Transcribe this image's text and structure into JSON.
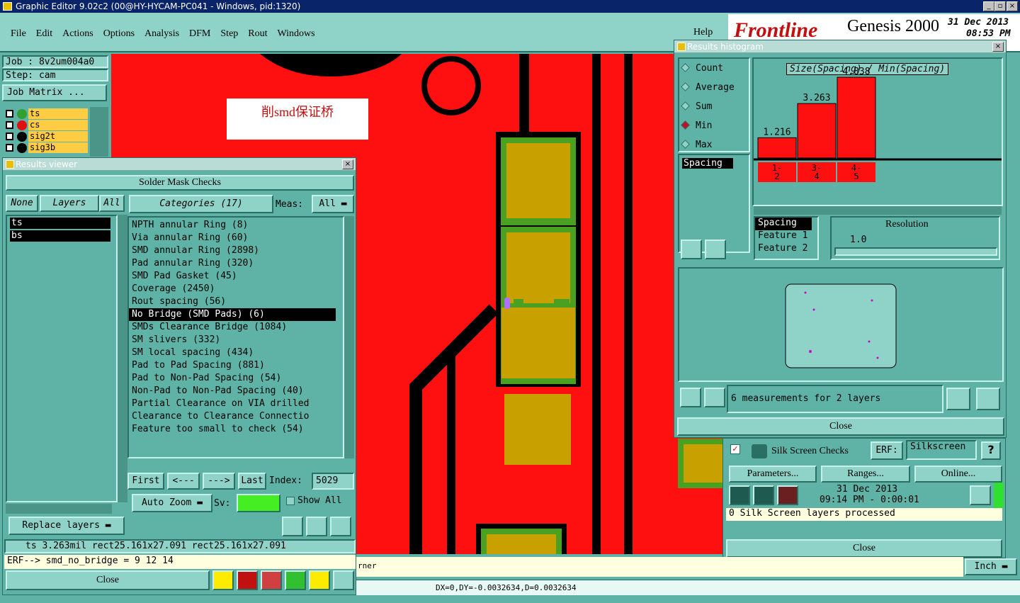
{
  "titlebar": {
    "title": "Graphic Editor 9.02c2 (00@HY-HYCAM-PC041 - Windows, pid:1320)"
  },
  "menu": {
    "items": [
      "File",
      "Edit",
      "Actions",
      "Options",
      "Analysis",
      "DFM",
      "Step",
      "Rout",
      "Windows"
    ],
    "help": "Help"
  },
  "brand": {
    "logo": "Frontline",
    "product": "Genesis 2000",
    "date": "31 Dec 2013",
    "time": "08:53 PM"
  },
  "job": {
    "job": "Job : 8v2um004a0",
    "step": "Step: cam",
    "matrix": "Job Matrix ..."
  },
  "layers": [
    {
      "name": "ts",
      "bg": "#ffcc44"
    },
    {
      "name": "cs",
      "bg": "#ffcc44"
    },
    {
      "name": "sig2t",
      "bg": "#ffcc44"
    },
    {
      "name": "sig3b",
      "bg": "#ffcc44"
    }
  ],
  "canvas": {
    "note": "削smd保证桥",
    "colors": {
      "background": "#ff1010",
      "pad": "#c8a000",
      "ring": "#4aa020",
      "trace": "#000000"
    }
  },
  "results_viewer": {
    "title": "Results viewer",
    "header": "Solder Mask Checks",
    "tabs": {
      "none": "None",
      "layers": "Layers",
      "all": "All"
    },
    "categories_label": "Categories (17)",
    "meas_label": "Meas:",
    "meas_value": "All",
    "layer_list": [
      "ts",
      "bs"
    ],
    "categories": [
      "NPTH annular Ring (8)",
      "Via annular Ring (60)",
      "SMD annular Ring (2898)",
      "Pad annular Ring (320)",
      "SMD Pad Gasket (45)",
      "Coverage (2450)",
      "Rout spacing (56)",
      "No Bridge (SMD Pads) (6)",
      "SMDs Clearance Bridge (1084)",
      "SM slivers (332)",
      "SM local spacing (434)",
      "Pad to Pad Spacing (881)",
      "Pad to Non-Pad Spacing (54)",
      "Non-Pad to Non-Pad Spacing (40)",
      "Partial Clearance on VIA drilled",
      "Clearance to Clearance Connectio",
      "Feature too small to check (54)"
    ],
    "selected_index": 7,
    "nav": {
      "first": "First",
      "prev": "<---",
      "next": "--->",
      "last": "Last",
      "index_label": "Index:",
      "index_value": "5029"
    },
    "auto_zoom": "Auto Zoom",
    "sv_label": "Sv:",
    "show_all": "Show All",
    "replace_layers": "Replace layers",
    "status1": "ts 3.263mil   rect25.161x27.091   rect25.161x27.091",
    "erf": "ERF--> smd_no_bridge = 9 12 14",
    "close": "Close",
    "icons": [
      "del-icon",
      "ref-icon",
      "undo-icon"
    ]
  },
  "histogram": {
    "title": "Results histogram",
    "modes": [
      "Count",
      "Average",
      "Sum",
      "Min",
      "Max"
    ],
    "selected_mode": "Min",
    "chart_title": "Size(Spacing) / Min(Spacing)",
    "bars": [
      {
        "value": "1.216",
        "label": "1-\n2",
        "v": 1.216
      },
      {
        "value": "3.263",
        "label": "3-\n4",
        "v": 3.263
      },
      {
        "value": "4.838",
        "label": "4-\n5",
        "v": 4.838
      }
    ],
    "spacing": "Spacing",
    "list": [
      "Spacing",
      "Feature 1",
      "Feature 2"
    ],
    "resolution_label": "Resolution",
    "resolution_value": "1.0",
    "measurements": "6 measurements for 2 layers",
    "close": "Close"
  },
  "silk": {
    "title": "Silk Screen Checks",
    "erf_label": "ERF:",
    "erf_value": "Silkscreen",
    "parameters": "Parameters...",
    "ranges": "Ranges...",
    "online": "Online...",
    "date": "31 Dec 2013",
    "time": "09:14 PM - 0:00:01",
    "status": "0 Silk Screen layers processed",
    "close": "Close"
  },
  "bottom": {
    "corner": "rner",
    "units": "Inch",
    "coords": "DX=0,DY=-0.0032634,D=0.0032634"
  }
}
